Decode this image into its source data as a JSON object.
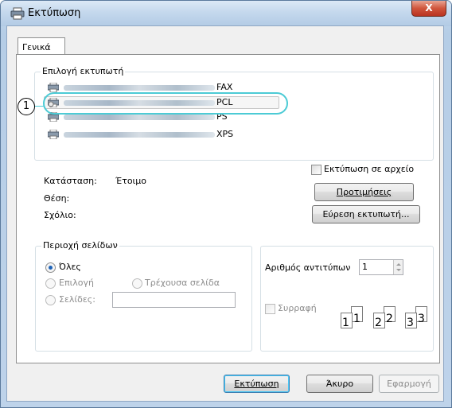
{
  "window": {
    "title": "Εκτύπωση",
    "close_label": "X"
  },
  "tabs": [
    {
      "label": "Γενικά"
    }
  ],
  "printer_section": {
    "title": "Επιλογή εκτυπωτή",
    "printers": [
      {
        "name": "FAX",
        "selected": false
      },
      {
        "name": "PCL",
        "selected": true
      },
      {
        "name": "PS",
        "selected": false
      },
      {
        "name": "XPS",
        "selected": false
      }
    ]
  },
  "callout": {
    "number": "1"
  },
  "status": {
    "status_label": "Κατάσταση:",
    "status_value": "Έτοιμο",
    "location_label": "Θέση:",
    "comment_label": "Σχόλιο:"
  },
  "print_to_file": {
    "label": "Εκτύπωση σε αρχείο",
    "checked": false
  },
  "preferences_button": "Προτιμήσεις",
  "find_printer_button": "Εύρεση εκτυπωτή...",
  "page_range": {
    "title": "Περιοχή σελίδων",
    "all": "Όλες",
    "selection": "Επιλογή",
    "current_page": "Τρέχουσα σελίδα",
    "pages": "Σελίδες:",
    "pages_value": ""
  },
  "copies": {
    "label": "Αριθμός αντιτύπων",
    "value": "1",
    "collate_label": "Συρραφή",
    "collate_checked": false,
    "collate_pages": [
      "1",
      "1",
      "2",
      "2",
      "3",
      "3"
    ]
  },
  "footer": {
    "print_button": "Εκτύπωση",
    "cancel_button": "Άκυρο",
    "apply_button": "Εφαρμογή"
  }
}
